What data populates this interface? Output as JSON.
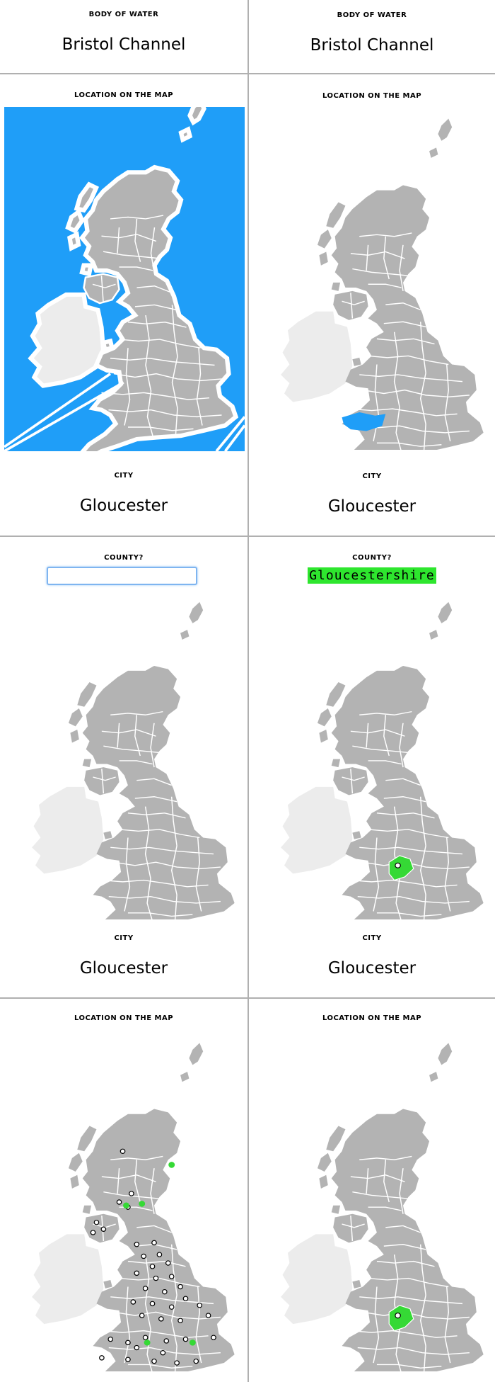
{
  "colors": {
    "land": "#b3b3b3",
    "ireland": "#ececec",
    "water": "#1f9ef8",
    "highlight": "#35d935",
    "divider": "#b0b0b0"
  },
  "cards": [
    {
      "front": {
        "prompt": "BODY OF WATER",
        "value": "Bristol Channel"
      },
      "back": {
        "prompt": "BODY OF WATER",
        "value": "Bristol Channel"
      }
    },
    {
      "front": {
        "prompt": "LOCATION ON THE MAP",
        "bottom_prompt": "CITY",
        "bottom_value": "Gloucester"
      },
      "back": {
        "prompt": "LOCATION ON THE MAP",
        "bottom_prompt": "CITY",
        "bottom_value": "Gloucester"
      }
    },
    {
      "front": {
        "prompt": "COUNTY?",
        "input_value": "",
        "bottom_prompt": "CITY",
        "bottom_value": "Gloucester"
      },
      "back": {
        "prompt": "COUNTY?",
        "answer": "Gloucestershire",
        "bottom_prompt": "CITY",
        "bottom_value": "Gloucester"
      }
    },
    {
      "front": {
        "prompt": "LOCATION ON THE MAP"
      },
      "back": {
        "prompt": "LOCATION ON THE MAP"
      }
    }
  ]
}
